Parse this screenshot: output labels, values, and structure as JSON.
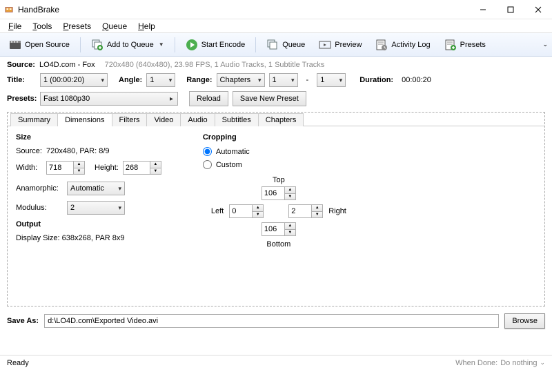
{
  "window": {
    "title": "HandBrake",
    "minimize": "—",
    "maximize": "☐",
    "close": "✕"
  },
  "menubar": [
    "File",
    "Tools",
    "Presets",
    "Queue",
    "Help"
  ],
  "toolbar": {
    "open_source": "Open Source",
    "add_queue": "Add to Queue",
    "start_encode": "Start Encode",
    "queue": "Queue",
    "preview": "Preview",
    "activity_log": "Activity Log",
    "presets": "Presets"
  },
  "source": {
    "label": "Source:",
    "name": "LO4D.com - Fox",
    "info": "720x480 (640x480), 23.98 FPS, 1 Audio Tracks, 1 Subtitle Tracks"
  },
  "title_row": {
    "title_label": "Title:",
    "title_value": "1 (00:00:20)",
    "angle_label": "Angle:",
    "angle_value": "1",
    "range_label": "Range:",
    "range_type": "Chapters",
    "range_from": "1",
    "range_sep": "-",
    "range_to": "1",
    "duration_label": "Duration:",
    "duration_value": "00:00:20"
  },
  "presets_row": {
    "label": "Presets:",
    "value": "Fast 1080p30",
    "reload": "Reload",
    "save_new": "Save New Preset"
  },
  "tabs": [
    "Summary",
    "Dimensions",
    "Filters",
    "Video",
    "Audio",
    "Subtitles",
    "Chapters"
  ],
  "active_tab": "Dimensions",
  "dimensions": {
    "size_heading": "Size",
    "source_label": "Source:",
    "source_value": "720x480, PAR: 8/9",
    "width_label": "Width:",
    "width_value": "718",
    "height_label": "Height:",
    "height_value": "268",
    "anamorphic_label": "Anamorphic:",
    "anamorphic_value": "Automatic",
    "modulus_label": "Modulus:",
    "modulus_value": "2",
    "output_heading": "Output",
    "display_size": "Display Size: 638x268,  PAR 8x9",
    "cropping_heading": "Cropping",
    "automatic": "Automatic",
    "custom": "Custom",
    "top_label": "Top",
    "top_value": "106",
    "bottom_label": "Bottom",
    "bottom_value": "106",
    "left_label": "Left",
    "left_value": "0",
    "right_label": "Right",
    "right_value": "2"
  },
  "save_as": {
    "label": "Save As:",
    "path": "d:\\LO4D.com\\Exported Video.avi",
    "browse": "Browse"
  },
  "statusbar": {
    "left": "Ready",
    "when_done_label": "When Done:",
    "when_done_value": "Do nothing"
  }
}
